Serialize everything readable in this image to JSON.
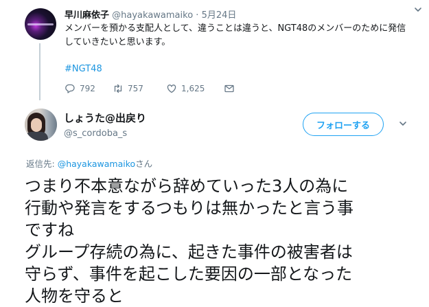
{
  "parent_tweet": {
    "display_name": "早川麻依子",
    "handle": "@hayakawamaiko",
    "separator": "·",
    "date": "5月24日",
    "text": "メンバーを預かる支配人として、違うことは違うと、NGT48のメンバーのために発信していきたいと思います。",
    "hashtag": "#NGT48",
    "replies": "792",
    "retweets": "757",
    "likes": "1,625",
    "icons": [
      "reply-icon",
      "retweet-icon",
      "like-icon",
      "direct-message-icon",
      "chevron-down-icon"
    ]
  },
  "reply_tweet": {
    "display_name": "しょうた@出戻り",
    "handle": "@s_cordoba_s",
    "follow_label": "フォローする",
    "reply_prefix": "返信先: ",
    "reply_mention": "@hayakawamaiko",
    "reply_suffix": "さん",
    "text": "つまり不本意ながら辞めていった3人の為に\n行動や発言をするつもりは無かったと言う事\nですね\nグループ存続の為に、起きた事件の被害者は\n守らず、事件を起こした要因の一部となった\n人物を守ると"
  },
  "colors": {
    "accent": "#1da1f2",
    "link": "#1b95e0",
    "secondary_text": "#657786",
    "primary_text": "#14171a"
  }
}
